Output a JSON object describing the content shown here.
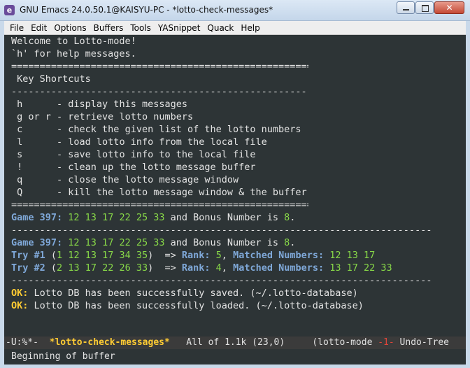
{
  "window": {
    "title": "GNU Emacs 24.0.50.1@KAISYU-PC - *lotto-check-messages*",
    "icon_letter": "e",
    "minimize": "minimize",
    "maximize": "maximize",
    "close": "✕"
  },
  "menu": [
    "File",
    "Edit",
    "Options",
    "Buffers",
    "Tools",
    "YASnippet",
    "Quack",
    "Help"
  ],
  "buffer": {
    "welcome": "Welcome to Lotto-mode!",
    "help_hint": "`h' for help messages.",
    "sep_double": "=========================================================================",
    "sep_single": "--------------------------------------------------------------------------------------------------------------",
    "shortcuts_title": " Key Shortcuts",
    "shortcuts": [
      {
        "key": " h     ",
        "desc": " - display this messages"
      },
      {
        "key": " g or r",
        "desc": " - retrieve lotto numbers"
      },
      {
        "key": " c     ",
        "desc": " - check the given list of the lotto numbers"
      },
      {
        "key": " l     ",
        "desc": " - load lotto info from the local file"
      },
      {
        "key": " s     ",
        "desc": " - save lotto info to the local file"
      },
      {
        "key": " !     ",
        "desc": " - clean up the lotto message buffer"
      },
      {
        "key": " q     ",
        "desc": " - close the lotto message window"
      },
      {
        "key": " Q     ",
        "desc": " - kill the lotto message window & the buffer"
      }
    ],
    "game1": {
      "label": "Game 397:",
      "numbers": "12 13 17 22 25 33",
      "bonus_text": " and Bonus Number is ",
      "bonus": "8",
      "end": "."
    },
    "game2": {
      "label": "Game 397:",
      "numbers": "12 13 17 22 25 33",
      "bonus_text": " and Bonus Number is ",
      "bonus": "8",
      "end": "."
    },
    "tries": [
      {
        "label": "Try #1",
        "open": " (",
        "first": "1",
        "rest": " 12 13 17 34 35",
        "close": ")  => ",
        "rank_label": "Rank:",
        "rank": " 5",
        "comma": ", ",
        "matched_label": "Matched Numbers:",
        "matched": " 12 13 17"
      },
      {
        "label": "Try #2",
        "open": " (",
        "first": "2",
        "rest": " 13 17 22 26 33",
        "close": ")  => ",
        "rank_label": "Rank:",
        "rank": " 4",
        "comma": ", ",
        "matched_label": "Matched Numbers:",
        "matched": " 13 17 22 33"
      }
    ],
    "messages": [
      {
        "tag": "OK:",
        "text": " Lotto DB has been successfully saved. (~/.lotto-database)"
      },
      {
        "tag": "OK:",
        "text": " Lotto DB has been successfully loaded. (~/.lotto-database)"
      }
    ]
  },
  "modeline": {
    "state": "-U:%*-  ",
    "buffer_name": "*lotto-check-messages*",
    "position": "   All of 1.1k (23,0)     ",
    "mode_open": "(lotto-mode ",
    "mode_flag": "-1-",
    "mode_rest": " Undo-Tree"
  },
  "echo": "Beginning of buffer"
}
